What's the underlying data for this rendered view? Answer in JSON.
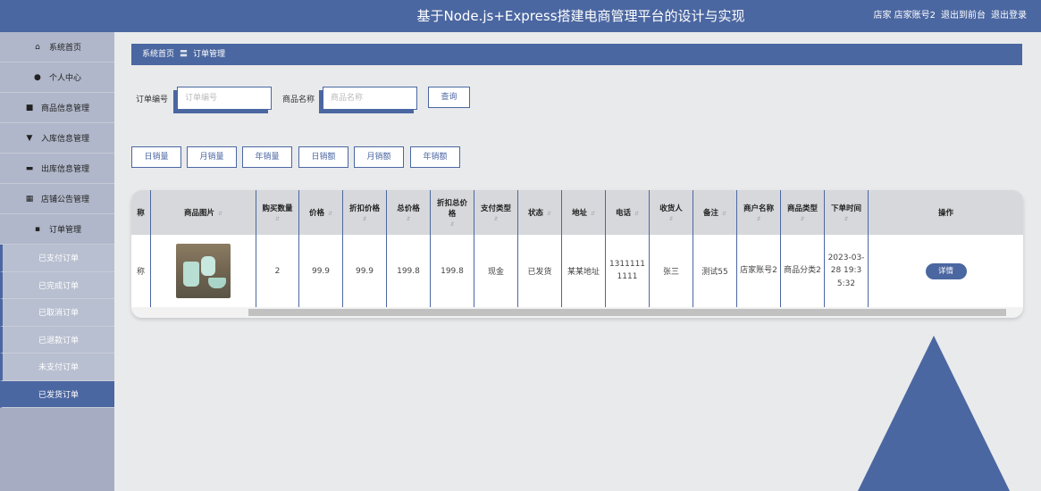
{
  "app": {
    "title": "基于Node.js+Express搭建电商管理平台的设计与实现"
  },
  "header": {
    "user_label": "店家 店家账号2",
    "front_link": "退出到前台",
    "logout_link": "退出登录"
  },
  "sidebar": {
    "items": [
      {
        "label": "系统首页",
        "icon": "home-icon"
      },
      {
        "label": "个人中心",
        "icon": "user-icon"
      },
      {
        "label": "商品信息管理",
        "icon": "video-icon"
      },
      {
        "label": "入库信息管理",
        "icon": "stamp-icon"
      },
      {
        "label": "出库信息管理",
        "icon": "briefcase-icon"
      },
      {
        "label": "店铺公告管理",
        "icon": "grid-icon"
      },
      {
        "label": "订单管理",
        "icon": "chat-icon"
      }
    ],
    "subitems": [
      "已支付订单",
      "已完成订单",
      "已取消订单",
      "已退款订单",
      "未支付订单",
      "已发货订单"
    ],
    "active_subitem": "已发货订单"
  },
  "breadcrumb": {
    "home": "系统首页",
    "separator": "〓",
    "current": "订单管理"
  },
  "search": {
    "order_no_label": "订单编号",
    "order_no_placeholder": "订单编号",
    "product_name_label": "商品名称",
    "product_name_placeholder": "商品名称",
    "query_button": "查询"
  },
  "stats_buttons": [
    "日销量",
    "月销量",
    "年销量",
    "日销额",
    "月销额",
    "年销额"
  ],
  "table": {
    "headers": [
      "称",
      "商品图片",
      "购买数量",
      "价格",
      "折扣价格",
      "总价格",
      "折扣总价格",
      "支付类型",
      "状态",
      "地址",
      "电话",
      "收货人",
      "备注",
      "商户名称",
      "商品类型",
      "下单时间",
      "操作"
    ],
    "rows": [
      {
        "name_partial": "称",
        "quantity": "2",
        "price": "99.9",
        "discount_price": "99.9",
        "total": "199.8",
        "discount_total": "199.8",
        "pay_type": "现金",
        "status": "已发货",
        "address": "某某地址",
        "phone": "13111111111",
        "receiver": "张三",
        "remark": "测试55",
        "merchant": "店家账号2",
        "category": "商品分类2",
        "order_time": "2023-03-28 19:35:32",
        "action": "详情"
      }
    ]
  },
  "colors": {
    "primary": "#4b67a1",
    "sidebar_bg": "#a6adc2",
    "page_bg": "#e9eaec"
  }
}
